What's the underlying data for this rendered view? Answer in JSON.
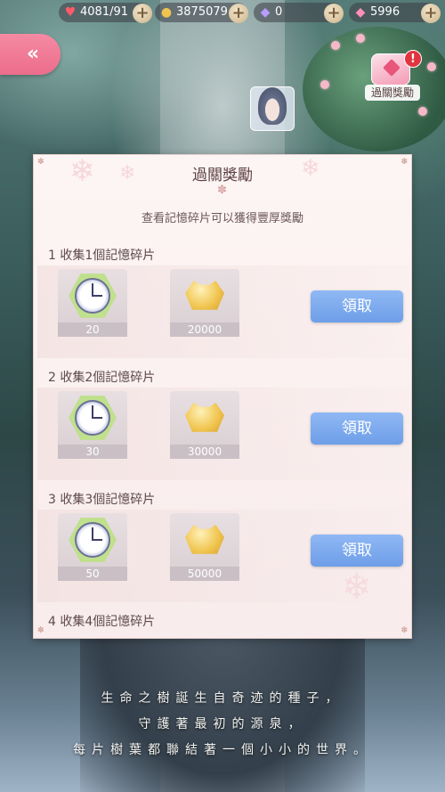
{
  "resources": [
    {
      "icon": "heart-icon",
      "glyph": "♥",
      "color": "#ff5a6a",
      "value": "4081/91"
    },
    {
      "icon": "cat-coin-icon",
      "glyph": "●",
      "color": "#f2c34f",
      "value": "3875079"
    },
    {
      "icon": "diamond-icon",
      "glyph": "◆",
      "color": "#b89cff",
      "value": "0"
    },
    {
      "icon": "pink-diamond-icon",
      "glyph": "◆",
      "color": "#ff8fb8",
      "value": "5996"
    }
  ],
  "plus_glyph": "+",
  "back_glyph": "«",
  "stage_reward": {
    "label": "過關獎勵",
    "alert": "!"
  },
  "panel": {
    "title": "過關獎勵",
    "subtitle": "查看記憶碎片可以獲得豐厚獎勵",
    "claim_label": "領取",
    "rows": [
      {
        "label": "1  收集1個記憶碎片",
        "clock_count": "20",
        "coin_count": "20000"
      },
      {
        "label": "2  收集2個記憶碎片",
        "clock_count": "30",
        "coin_count": "30000"
      },
      {
        "label": "3  收集3個記憶碎片",
        "clock_count": "50",
        "coin_count": "50000"
      },
      {
        "label": "4  收集4個記憶碎片"
      }
    ]
  },
  "poem": [
    "生命之樹誕生自奇迹的種子，",
    "守護著最初的源泉，",
    "每片樹葉都聯結著一個小小的世界。"
  ]
}
